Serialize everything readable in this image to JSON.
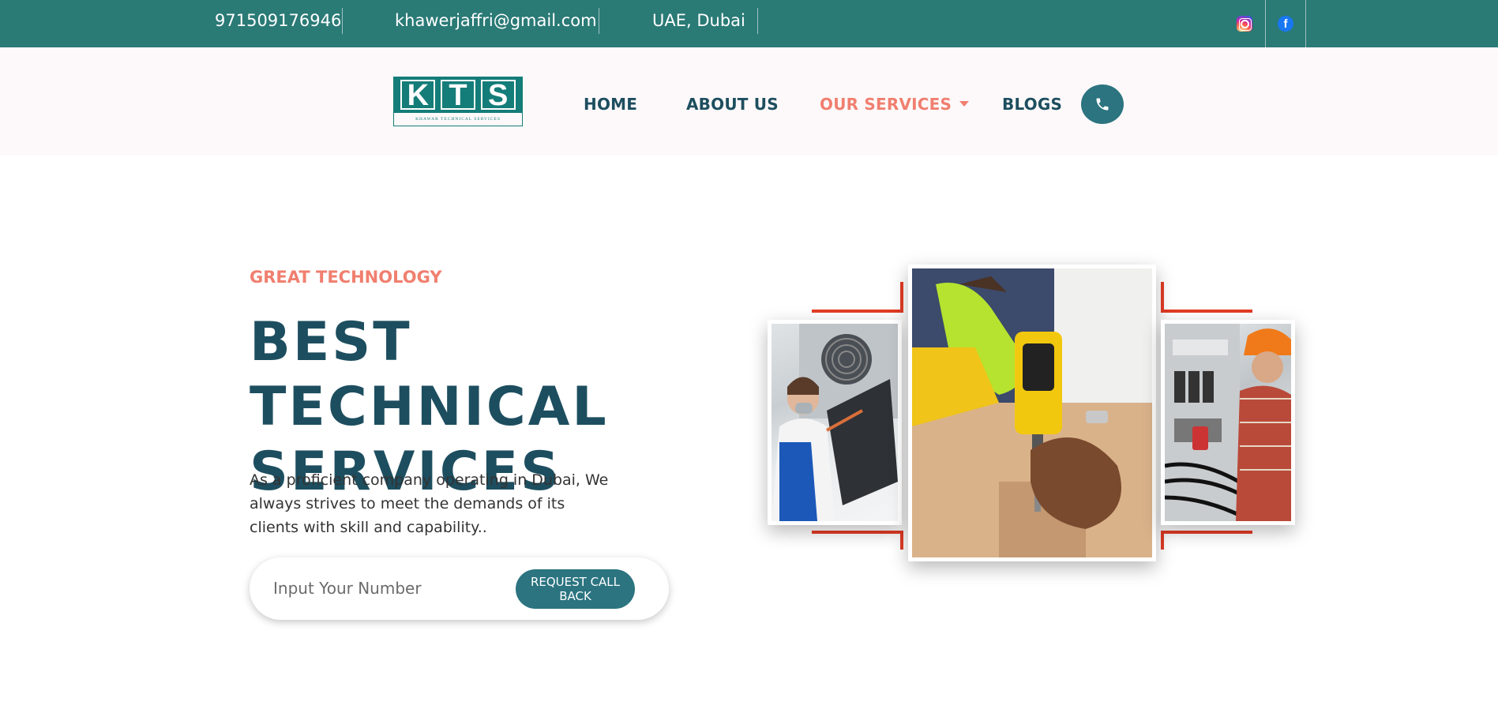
{
  "topbar": {
    "phone": "971509176946",
    "email": "khawerjaffri@gmail.com",
    "location": "UAE, Dubai",
    "social": [
      "instagram-icon",
      "facebook-icon"
    ],
    "facebook_glyph": "f"
  },
  "header": {
    "logo": {
      "letters": [
        "K",
        "T",
        "S"
      ],
      "subtitle": "KHAWAR TECHNICAL SERVICES"
    },
    "nav": [
      {
        "label": "HOME"
      },
      {
        "label": "ABOUT US"
      },
      {
        "label": "OUR SERVICES",
        "active": true,
        "dropdown": true
      },
      {
        "label": "BLOGS"
      }
    ],
    "phone_icon": "phone-icon"
  },
  "hero": {
    "eyebrow": "GREAT TECHNOLOGY",
    "title_line1": "BEST TECHNICAL",
    "title_line2": "SERVICES",
    "description": "As a proficient company operating in Dubai, We always strives to meet the demands of its clients with skill and capability..",
    "input_placeholder": "Input Your Number",
    "button_label": "REQUEST CALL BACK"
  },
  "colors": {
    "topbar": "#2a7a76",
    "primary": "#1d4e5f",
    "accent": "#f07f6f",
    "button": "#2b7480",
    "frame_accent": "#e33c26"
  }
}
